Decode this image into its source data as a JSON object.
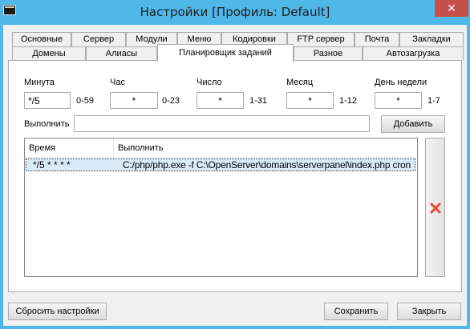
{
  "window": {
    "title": "Настройки [Профиль: Default]",
    "close_glyph": "✕"
  },
  "tabs": {
    "row1": [
      "Основные",
      "Сервер",
      "Модули",
      "Меню",
      "Кодировки",
      "FTP сервер",
      "Почта",
      "Закладки"
    ],
    "row2": [
      "Домены",
      "Алиасы",
      "Планировщик заданий",
      "Разное",
      "Автозагрузка"
    ],
    "active": "Планировщик заданий"
  },
  "scheduler": {
    "minute": {
      "label": "Минута",
      "value": "*/5",
      "range": "0-59"
    },
    "hour": {
      "label": "Час",
      "value": "*",
      "range": "0-23"
    },
    "day": {
      "label": "Число",
      "value": "*",
      "range": "1-31"
    },
    "month": {
      "label": "Месяц",
      "value": "*",
      "range": "1-12"
    },
    "weekday": {
      "label": "День недели",
      "value": "*",
      "range": "1-7"
    },
    "execute_label": "Выполнить",
    "execute_value": "",
    "add_button": "Добавить",
    "table": {
      "columns": [
        "Время",
        "Выполнить"
      ],
      "rows": [
        {
          "time": "*/5 * * * *",
          "command": "C:/php/php.exe -f C:\\OpenServer\\domains\\serverpanel\\index.php cron"
        }
      ]
    },
    "delete_icon": "red-x-icon"
  },
  "footer": {
    "reset_button": "Сбросить настройки",
    "save_button": "Сохранить",
    "close_button": "Закрыть"
  },
  "colors": {
    "titlebar": "#4fb8e8",
    "close_button": "#c74f4a",
    "selection": "#d9ebf9",
    "delete_icon": "#e84a2a"
  }
}
